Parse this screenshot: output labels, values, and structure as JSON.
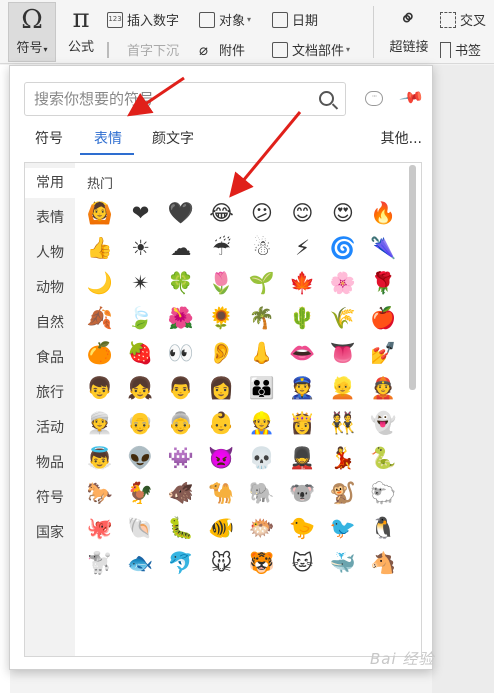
{
  "ribbon": {
    "symbol": {
      "glyph": "Ω",
      "label": "符号"
    },
    "formula": {
      "glyph": "π",
      "label": "公式"
    },
    "insert_number": "插入数字",
    "object": "对象",
    "date": "日期",
    "first_drop_cap": "首字下沉",
    "attachment": "附件",
    "doc_parts": "文档部件",
    "hyperlink": "超链接",
    "cross_ref": "交叉",
    "bookmark": "书签"
  },
  "popup": {
    "search_placeholder": "搜索你想要的符号",
    "tabs": [
      "符号",
      "表情",
      "颜文字"
    ],
    "active_tab": "表情",
    "more": "其他...",
    "categories": [
      "常用",
      "表情",
      "人物",
      "动物",
      "自然",
      "食品",
      "旅行",
      "活动",
      "物品",
      "符号",
      "国家"
    ],
    "grid_title": "热门",
    "emojis": [
      [
        "🙆",
        "❤",
        "🖤",
        "😂",
        "😕",
        "😊",
        "😍",
        "🔥"
      ],
      [
        "👍",
        "☀",
        "☁",
        "☔",
        "☃",
        "⚡",
        "🌀",
        "🌂"
      ],
      [
        "🌙",
        "✴",
        "🍀",
        "🌷",
        "🌱",
        "🍁",
        "🌸",
        "🌹"
      ],
      [
        "🍂",
        "🍃",
        "🌺",
        "🌻",
        "🌴",
        "🌵",
        "🌾",
        "🍎"
      ],
      [
        "🍊",
        "🍓",
        "👀",
        "👂",
        "👃",
        "👄",
        "👅",
        "💅"
      ],
      [
        "👦",
        "👧",
        "👨",
        "👩",
        "👪",
        "👮",
        "👱",
        "👲"
      ],
      [
        "👳",
        "👴",
        "👵",
        "👶",
        "👷",
        "👸",
        "👯",
        "👻"
      ],
      [
        "👼",
        "👽",
        "👾",
        "👿",
        "💀",
        "💂",
        "💃",
        "🐍"
      ],
      [
        "🐎",
        "🐓",
        "🐗",
        "🐪",
        "🐘",
        "🐨",
        "🐒",
        "🐑"
      ],
      [
        "🐙",
        "🐚",
        "🐛",
        "🐠",
        "🐡",
        "🐤",
        "🐦",
        "🐧"
      ],
      [
        "🐩",
        "🐟",
        "🐬",
        "🐭",
        "🐯",
        "🐱",
        "🐳",
        "🐴"
      ]
    ]
  },
  "watermark": "Bai 经验"
}
